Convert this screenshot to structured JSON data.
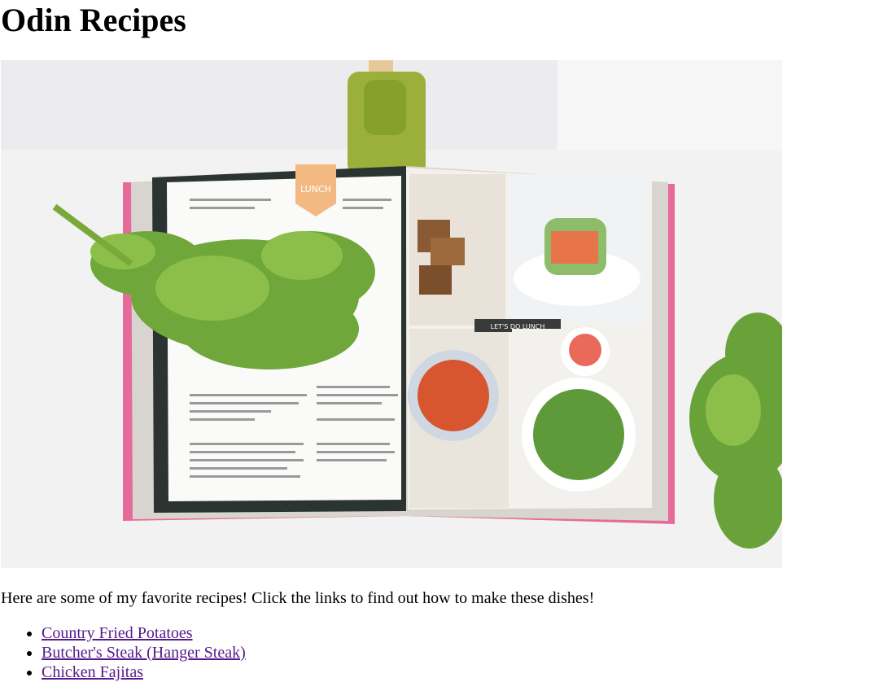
{
  "page": {
    "title": "Odin Recipes",
    "hero_image": {
      "description": "open recipe book with LUNCH pages",
      "book_labels": {
        "tab": "LUNCH",
        "banner": "LET'S DO LUNCH"
      }
    },
    "intro": "Here are some of my favorite recipes! Click the links to find out how to make these dishes!",
    "recipes": [
      {
        "label": "Country Fried Potatoes"
      },
      {
        "label": "Butcher's Steak (Hanger Steak)"
      },
      {
        "label": "Chicken Fajitas"
      }
    ]
  },
  "colors": {
    "link_visited": "#551a8b",
    "text": "#000000",
    "background": "#ffffff"
  }
}
